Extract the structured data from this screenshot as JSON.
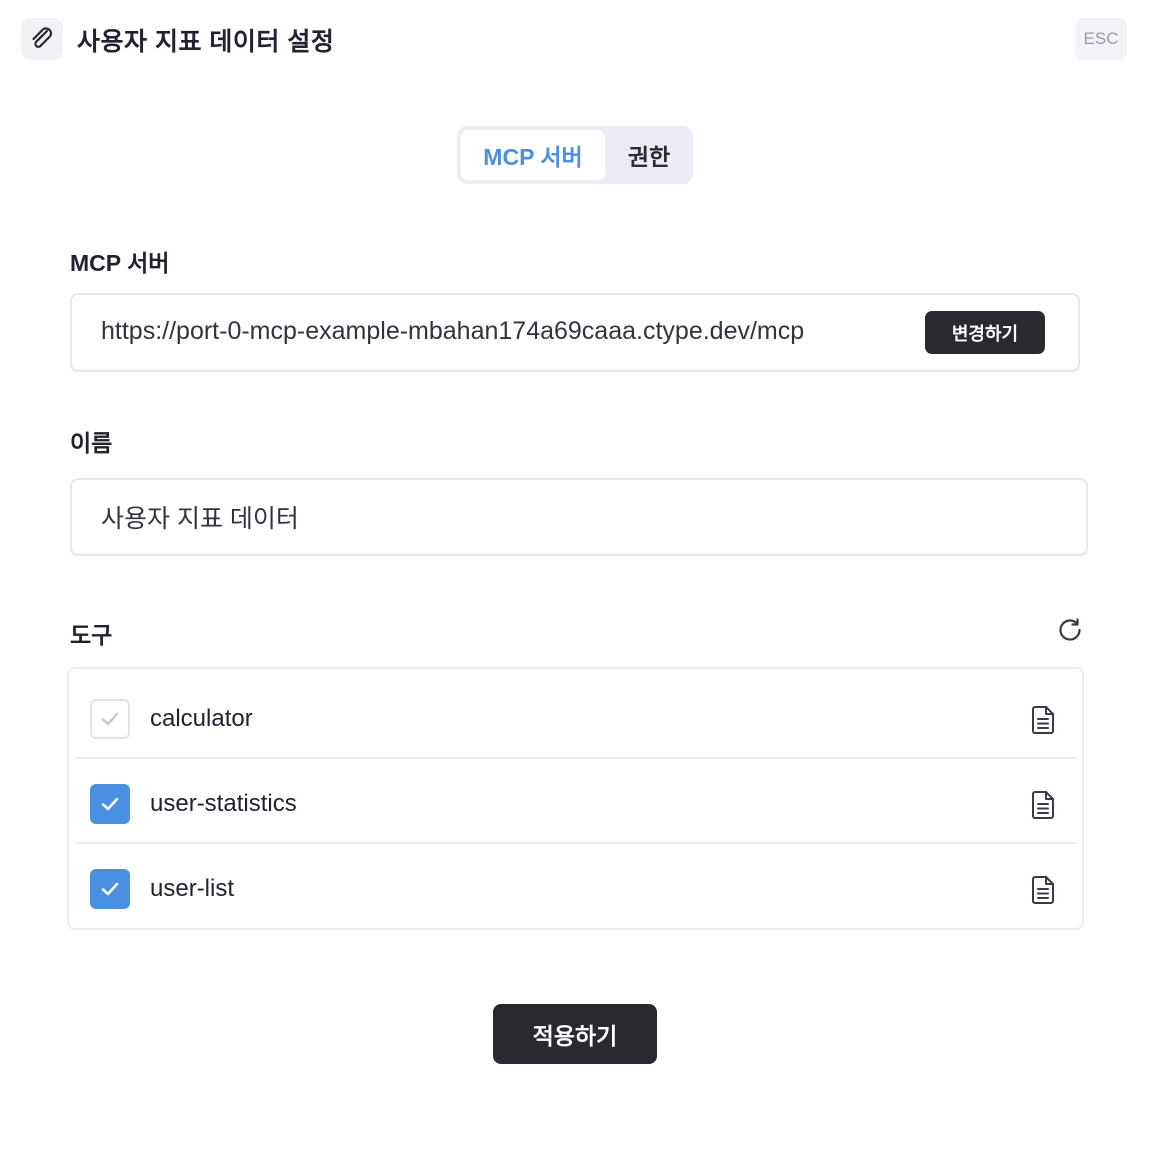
{
  "header": {
    "title": "사용자 지표 데이터 설정",
    "esc_label": "ESC",
    "logo_icon": "paperclip-icon"
  },
  "tabs": [
    {
      "label": "MCP 서버",
      "active": true
    },
    {
      "label": "권한",
      "active": false
    }
  ],
  "mcp_server": {
    "label": "MCP 서버",
    "url": "https://port-0-mcp-example-mbahan174a69caaa.ctype.dev/mcp",
    "change_label": "변경하기"
  },
  "name": {
    "label": "이름",
    "value": "사용자 지표 데이터"
  },
  "tools": {
    "label": "도구",
    "refresh_icon": "refresh-icon",
    "items": [
      {
        "name": "calculator",
        "checked": true,
        "disabled": true
      },
      {
        "name": "user-statistics",
        "checked": true,
        "disabled": false
      },
      {
        "name": "user-list",
        "checked": true,
        "disabled": false
      }
    ]
  },
  "apply_label": "적용하기",
  "colors": {
    "accent": "#4a8fe2",
    "dark_button": "#29292f",
    "border": "#e6e6ee"
  }
}
